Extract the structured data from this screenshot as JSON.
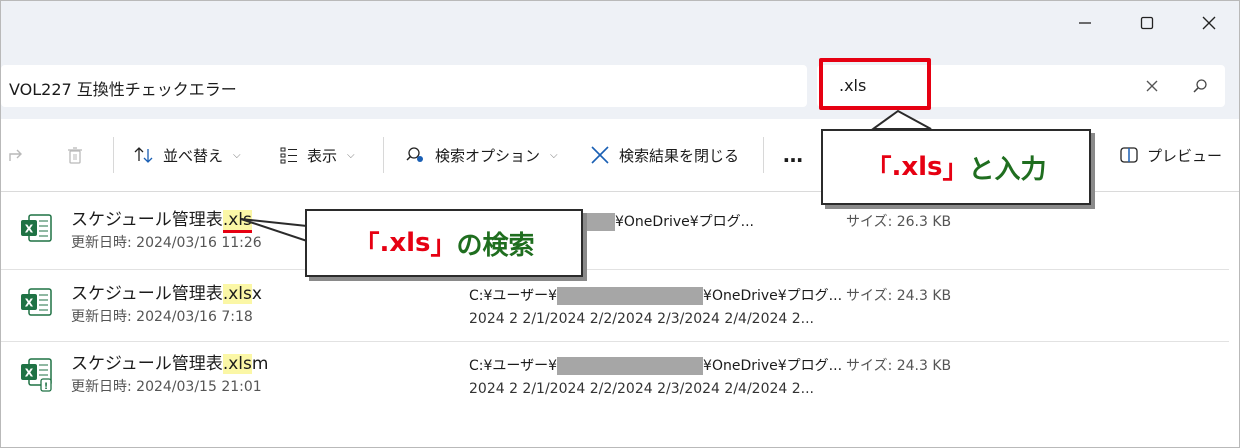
{
  "window": {
    "controls": [
      "minimize",
      "maximize",
      "close"
    ]
  },
  "address": {
    "path": "VOL227 互換性チェックエラー"
  },
  "search": {
    "value": ".xls",
    "clear_icon": "close-icon",
    "search_icon": "search-icon"
  },
  "toolbar": {
    "sort_label": "並べ替え",
    "view_label": "表示",
    "search_options_label": "検索オプション",
    "close_search_label": "検索結果を閉じる",
    "more_label": "…",
    "preview_label": "プレビュー"
  },
  "files": [
    {
      "name_base": "スケジュール管理表",
      "name_match": ".xls",
      "name_rest": "",
      "modified_label": "更新日時:",
      "modified": "2024/03/16 11:26",
      "path_prefix": "",
      "path_suffix": "¥OneDrive¥プログ...",
      "extra": "",
      "size": "サイズ: 26.3 KB"
    },
    {
      "name_base": "スケジュール管理表",
      "name_match": ".xls",
      "name_rest": "x",
      "modified_label": "更新日時:",
      "modified": "2024/03/16 7:18",
      "path_prefix": "C:¥ユーザー¥",
      "path_suffix": "¥OneDrive¥プログ...",
      "extra": "2024 2 2/1/2024 2/2/2024 2/3/2024 2/4/2024 2...",
      "size": "サイズ: 24.3 KB"
    },
    {
      "name_base": "スケジュール管理表",
      "name_match": ".xls",
      "name_rest": "m",
      "modified_label": "更新日時:",
      "modified": "2024/03/15 21:01",
      "path_prefix": "C:¥ユーザー¥",
      "path_suffix": "¥OneDrive¥プログ...",
      "extra": "2024 2 2/1/2024 2/2/2024 2/3/2024 2/4/2024 2...",
      "size": "サイズ: 24.3 KB"
    }
  ],
  "annotations": {
    "input_callout_open": "「",
    "input_callout_ext": " .xls ",
    "input_callout_close": "」",
    "input_callout_text": " と入力",
    "search_callout_open": "「",
    "search_callout_ext": " .xls ",
    "search_callout_close": "」",
    "search_callout_text": " の検索"
  },
  "colors": {
    "accent_red": "#e60012",
    "callout_green": "#1f6e1f",
    "highlight": "#fbf7a6",
    "excel_green": "#1f7244"
  }
}
